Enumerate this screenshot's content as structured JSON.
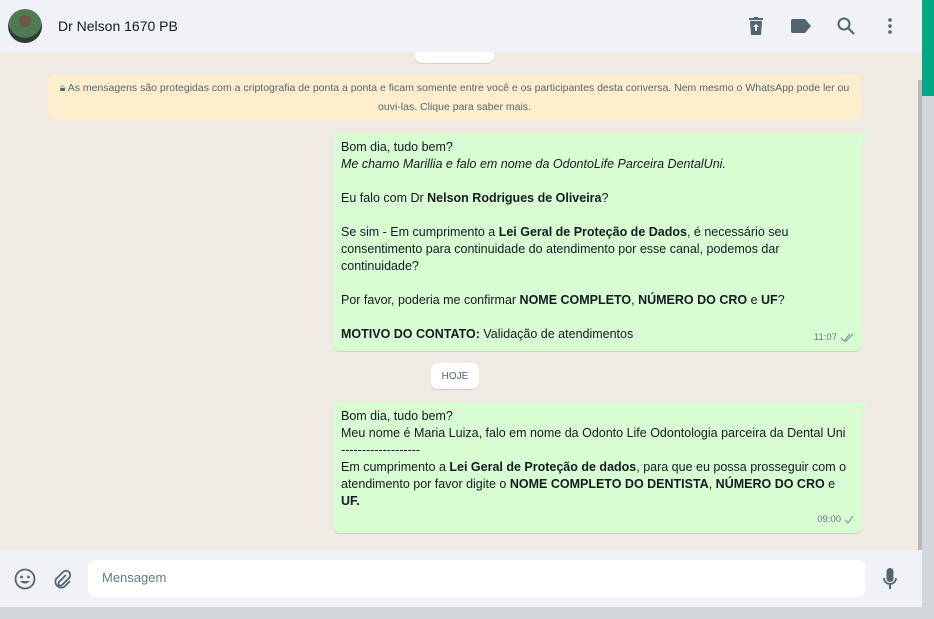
{
  "header": {
    "contact_name": "Dr Nelson 1670 PB",
    "icons": [
      "delete-icon",
      "label-icon",
      "search-icon",
      "menu-icon"
    ]
  },
  "encryption_notice": "As mensagens são protegidas com a criptografia de ponta a ponta e ficam somente entre você e os participantes desta conversa. Nem mesmo o WhatsApp pode ler ou ouvi-las. Clique para saber mais.",
  "date_divider": "HOJE",
  "messages": [
    {
      "time": "11:07",
      "status": "read",
      "lines": [
        [
          {
            "t": "Bom dia, tudo bem?"
          }
        ],
        [
          {
            "t": "Me chamo Marillia e falo em nome da OdontoLife Parceira DentalUni.",
            "i": true
          }
        ],
        [],
        [
          {
            "t": "Eu falo com Dr "
          },
          {
            "t": "Nelson Rodrigues de Oliveira",
            "b": true
          },
          {
            "t": "?"
          }
        ],
        [],
        [
          {
            "t": "Se sim - Em cumprimento a "
          },
          {
            "t": "Lei Geral de Proteção de Dados",
            "b": true
          },
          {
            "t": ", é necessário seu consentimento para continuidade do atendimento por esse canal, podemos dar continuidade?"
          }
        ],
        [],
        [
          {
            "t": "Por favor, poderia me confirmar "
          },
          {
            "t": "NOME COMPLETO",
            "b": true
          },
          {
            "t": ", "
          },
          {
            "t": "NÚMERO DO CRO",
            "b": true
          },
          {
            "t": " e "
          },
          {
            "t": "UF",
            "b": true
          },
          {
            "t": "?"
          }
        ],
        [],
        [
          {
            "t": "MOTIVO DO CONTATO:",
            "b": true
          },
          {
            "t": " Validação de atendimentos"
          }
        ]
      ]
    },
    {
      "time": "09:00",
      "status": "sent",
      "lines": [
        [
          {
            "t": "Bom dia,  tudo bem?"
          }
        ],
        [
          {
            "t": "Meu nome é Maria Luiza, falo em nome da Odonto Life Odontologia parceira da Dental Uni"
          }
        ],
        [
          {
            "t": "-------------------"
          }
        ],
        [
          {
            "t": "Em cumprimento a "
          },
          {
            "t": "Lei Geral de Proteção de dados",
            "b": true
          },
          {
            "t": ", para que eu possa prosseguir com o atendimento por favor digite o "
          },
          {
            "t": "NOME COMPLETO DO DENTISTA",
            "b": true
          },
          {
            "t": ", "
          },
          {
            "t": "NÚMERO DO CRO",
            "b": true
          },
          {
            "t": " e "
          },
          {
            "t": "UF.",
            "b": true
          }
        ]
      ]
    }
  ],
  "composer": {
    "placeholder": "Mensagem"
  }
}
